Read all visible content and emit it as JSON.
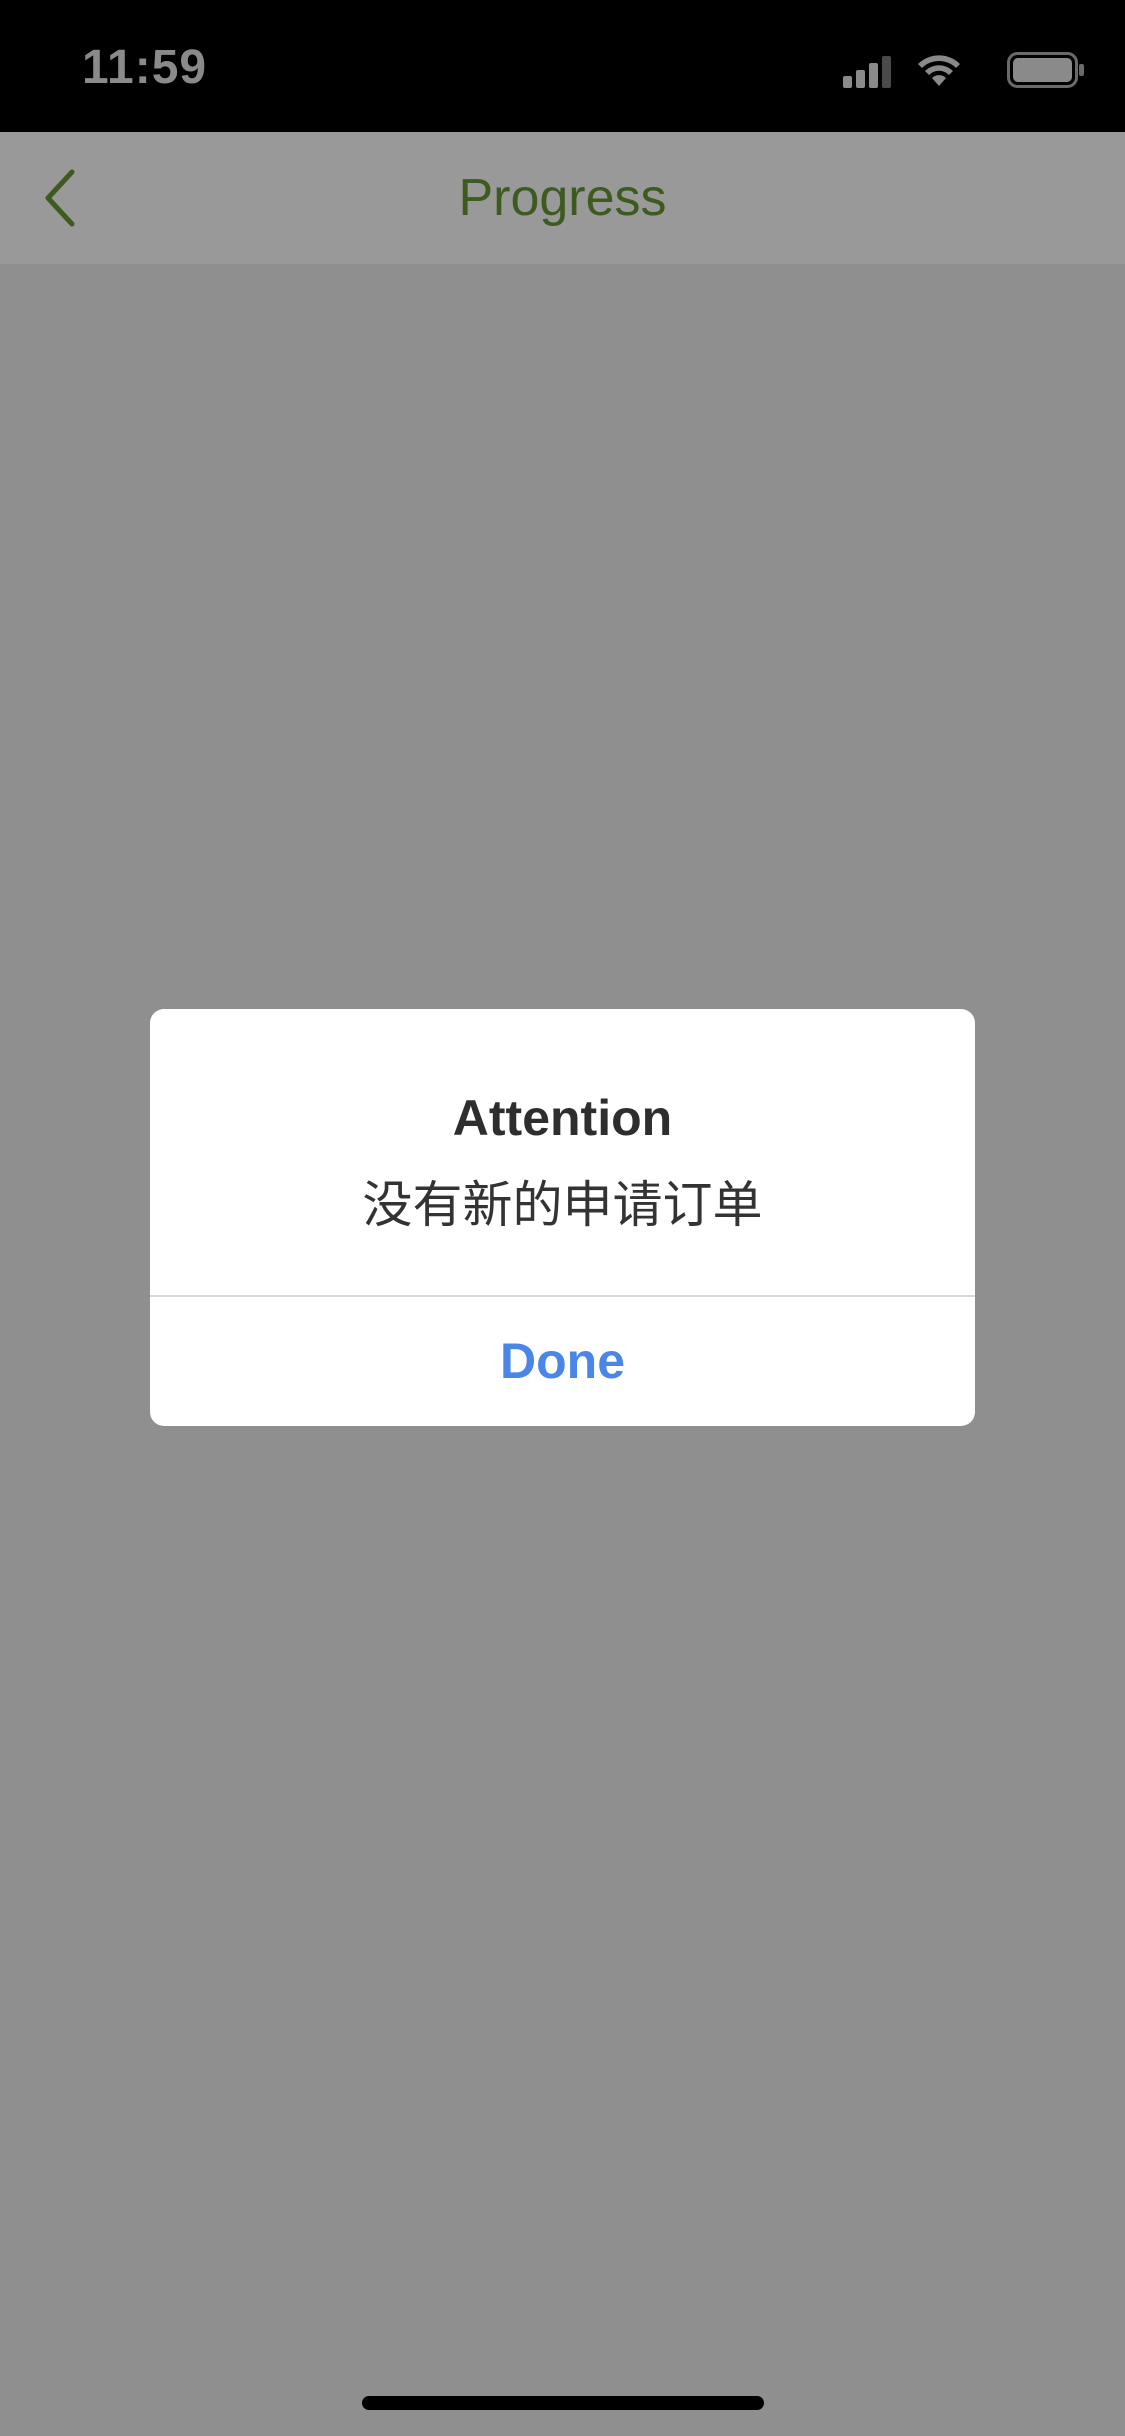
{
  "status_bar": {
    "time": "11:59",
    "icons": [
      "signal-icon",
      "wifi-icon",
      "battery-icon"
    ]
  },
  "nav": {
    "title": "Progress",
    "back_icon": "chevron-left-icon",
    "title_color": "#3d5a1f"
  },
  "alert": {
    "title": "Attention",
    "message": "没有新的申请订单",
    "button_label": "Done",
    "button_color": "#4a86e8"
  },
  "colors": {
    "overlay": "#8f8f8f",
    "nav_background": "#999999",
    "status_bar_background": "#000000"
  }
}
